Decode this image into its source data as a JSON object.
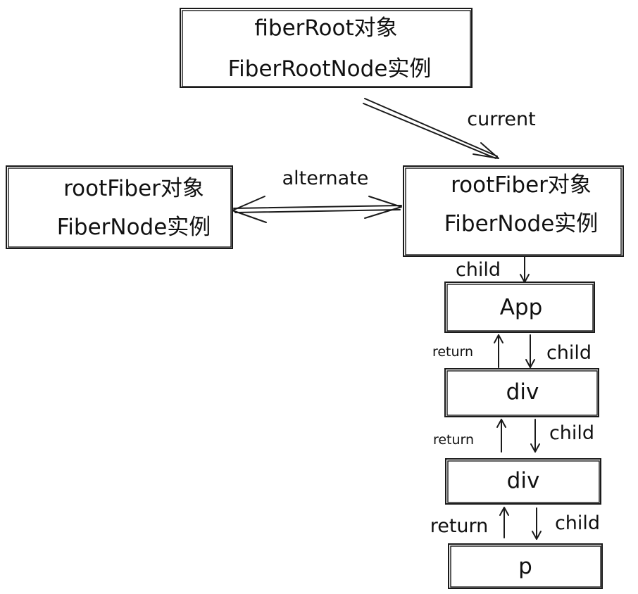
{
  "nodes": {
    "fiber_root": {
      "line1": "fiberRoot对象",
      "line2": "FiberRootNode实例"
    },
    "alt_root_fiber": {
      "line1": "rootFiber对象",
      "line2": "FiberNode实例"
    },
    "cur_root_fiber": {
      "line1": "rootFiber对象",
      "line2": "FiberNode实例"
    },
    "app": {
      "label": "App"
    },
    "div1": {
      "label": "div"
    },
    "div2": {
      "label": "div"
    },
    "p": {
      "label": "p"
    }
  },
  "edges": {
    "current": "current",
    "alternate": "alternate",
    "child_root_app": "child",
    "child_app_div": "child",
    "return_div_app": "return",
    "child_div_div": "child",
    "return_div_div": "return",
    "child_div_p": "child",
    "return_p_div": "return"
  }
}
